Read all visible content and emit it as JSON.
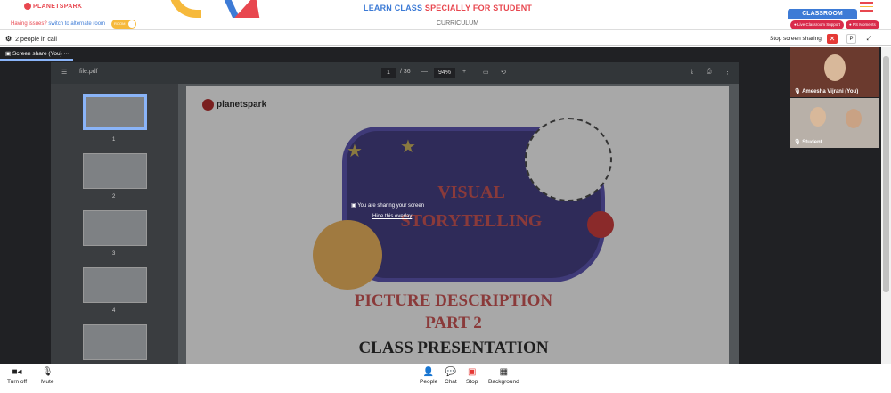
{
  "topbar": {
    "logo": "PLANETSPARK",
    "headline_a": "LEARN CLASS",
    "headline_b": "SPECIALLY FOR STUDENT",
    "classroom": "CLASSROOM"
  },
  "subbar": {
    "issues_q": "Having issues?",
    "issues_link": "switch to alternate room",
    "toggle_label": "ROOM",
    "curriculum": "CURRICULUM",
    "support": "Live Classroom Support",
    "moments": "PS Moments"
  },
  "call": {
    "people": "2 people in call",
    "stop_share": "Stop screen sharing",
    "close": "✕",
    "pin": "P",
    "expand": "⤢"
  },
  "share_tab": {
    "label": "Screen share (You)",
    "more": "⋯"
  },
  "pdf": {
    "filename": "file.pdf",
    "page": "1",
    "total": "/ 36",
    "zoom": "94%",
    "minus": "—",
    "plus": "+"
  },
  "thumbnails": [
    "1",
    "2",
    "3",
    "4"
  ],
  "slide": {
    "brand": "planetspark",
    "title1": "VISUAL",
    "title2": "STORYTELLING",
    "pd1": "PICTURE DESCRIPTION",
    "pd2": "PART 2",
    "cp": "CLASS PRESENTATION"
  },
  "overlay": {
    "sharing": "You are sharing your screen",
    "hide": "Hide this overlay"
  },
  "participants": [
    {
      "name": "Ameesha Vijrani (You)"
    },
    {
      "name": "Student"
    }
  ],
  "controls": {
    "turn_off": "Turn off",
    "mute": "Mute",
    "people": "People",
    "chat": "Chat",
    "stop": "Stop",
    "background": "Background"
  },
  "colors": {
    "accent_blue": "#3d7bd6",
    "accent_red": "#e8474f",
    "accent_yellow": "#f6b93b"
  }
}
